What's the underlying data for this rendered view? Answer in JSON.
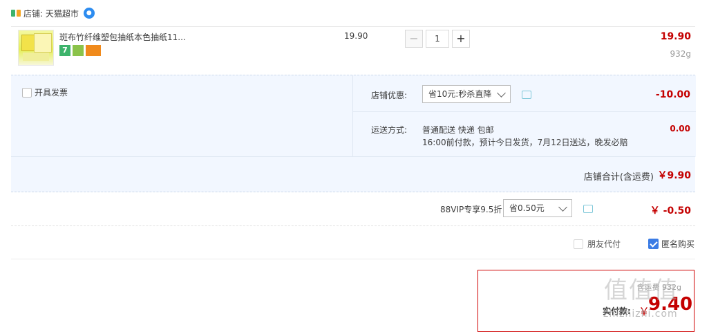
{
  "shop": {
    "name": "店铺: 天猫超市"
  },
  "item": {
    "title": "斑布竹纤维塑包抽纸本色抽纸11...",
    "unit_price": "19.90",
    "quantity": "1",
    "qty_minus": "−",
    "qty_plus": "+",
    "total": "19.90",
    "weight": "932g",
    "badge_7": "7"
  },
  "options": {
    "invoice_label": "开具发票",
    "shop_discount_label": "店铺优惠:",
    "shop_discount_selected": "省10元:秒杀直降",
    "shop_discount_value": "-10.00",
    "shipping_label": "运送方式:",
    "shipping_line1": "普通配送 快递 包邮",
    "shipping_line2": "16:00前付款，预计今日发货，7月12日送达，晚发必赔",
    "shipping_fee": "0.00"
  },
  "shop_total": {
    "label": "店铺合计(含运费)",
    "value": "￥9.90"
  },
  "vip": {
    "label": "88VIP专享9.5折",
    "selected": "省0.50元",
    "value": "￥ -0.50"
  },
  "pay_options": {
    "friend_pay": "朋友代付",
    "anonymous": "匿名购买"
  },
  "payment": {
    "pre_label": "含运费 932g",
    "label": "实付款:",
    "currency": "￥",
    "amount": "9.40"
  },
  "watermark": {
    "logo": "值值值",
    "text": "zhizhizhi.com"
  },
  "colors": {
    "price_red": "#c40000",
    "panel_bg": "#f2f7ff",
    "checkbox_blue": "#3b7ce5"
  }
}
